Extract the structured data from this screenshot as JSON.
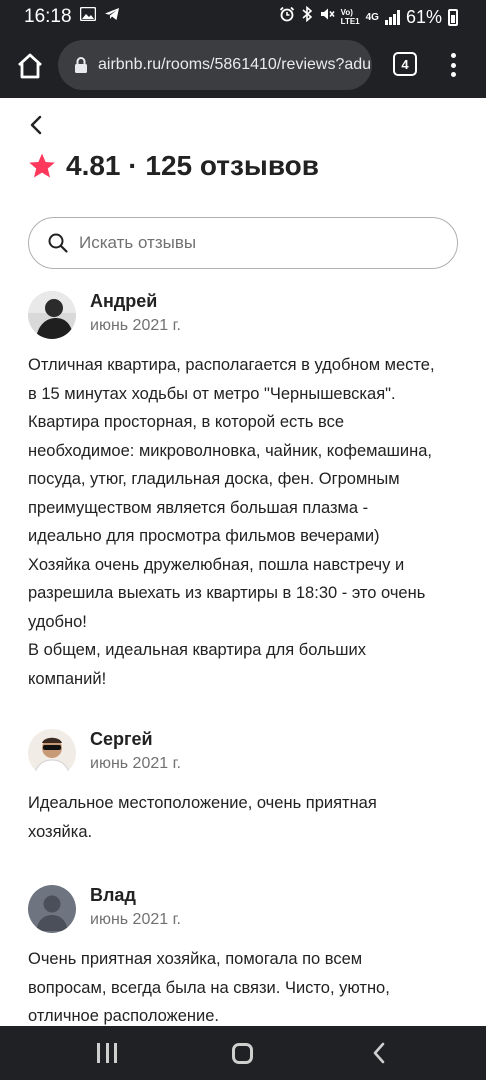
{
  "status_bar": {
    "time": "16:18",
    "network": "4G",
    "network_sub": "LTE1",
    "volte": "Vo)",
    "battery": "61%"
  },
  "browser": {
    "url": "airbnb.ru/rooms/5861410/reviews?adult",
    "tab_count": "4"
  },
  "header": {
    "rating_text": "4.81 · 125 отзывов",
    "star_color": "#ff385c"
  },
  "search": {
    "placeholder": "Искать отзывы"
  },
  "reviews": [
    {
      "name": "Андрей",
      "date": "июнь 2021 г.",
      "text": "Отличная квартира, располагается в удобном месте,\nв 15 минутах ходьбы от метро \"Чернышевская\".\nКвартира просторная, в которой есть все\nнеобходимое: микроволновка, чайник, кофемашина,\nпосуда, утюг, гладильная доска, фен. Огромным\nпреимуществом является большая плазма -\nидеально для просмотра фильмов вечерами)\nХозяйка очень дружелюбная, пошла навстречу и\nразрешила выехать из квартиры в 18:30 - это очень\nудобно!\nВ общем, идеальная квартира для больших\nкомпаний!"
    },
    {
      "name": "Сергей",
      "date": "июнь 2021 г.",
      "text": "Идеальное местоположение, очень приятная\nхозяйка."
    },
    {
      "name": "Влад",
      "date": "июнь 2021 г.",
      "text": "Очень приятная хозяйка, помогала по всем\nвопросам, всегда была на связи. Чисто, уютно,\nотличное расположение."
    }
  ]
}
